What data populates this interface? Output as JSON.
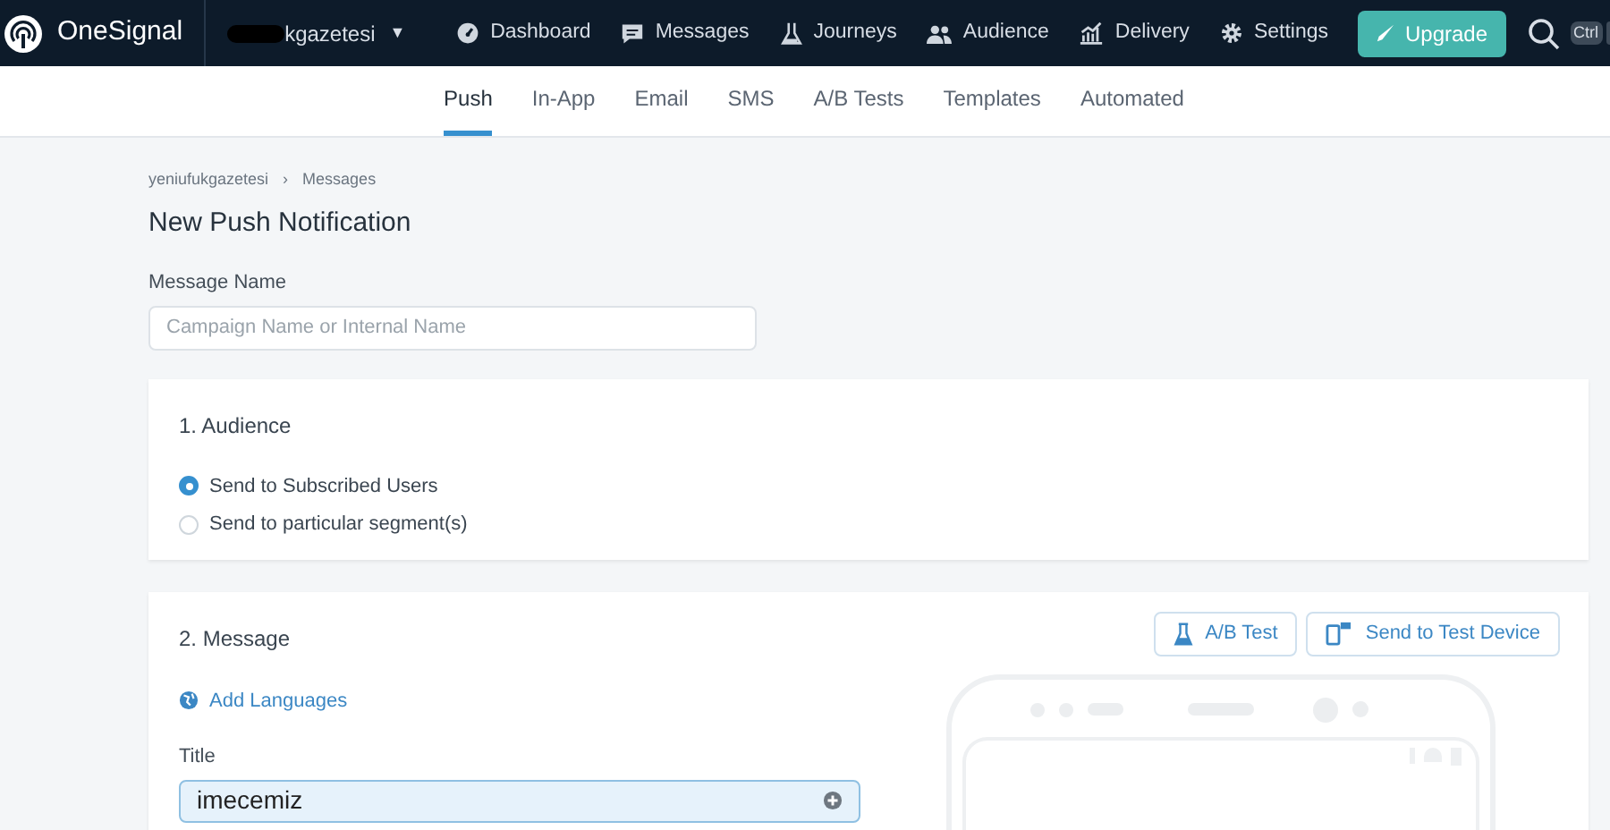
{
  "topbar": {
    "brand": "OneSignal",
    "app_name": "kgazetesi",
    "app_caret": "▼",
    "nav": [
      {
        "label": "Dashboard",
        "kind": "dashboard"
      },
      {
        "label": "Messages",
        "kind": "messages"
      },
      {
        "label": "Journeys",
        "kind": "journeys"
      },
      {
        "label": "Audience",
        "kind": "audience"
      },
      {
        "label": "Delivery",
        "kind": "delivery"
      },
      {
        "label": "Settings",
        "kind": "settings"
      }
    ],
    "upgrade": "Upgrade",
    "shortcut": "Ctrl"
  },
  "subnav": [
    {
      "label": "Push",
      "selected": true
    },
    {
      "label": "In-App",
      "selected": false
    },
    {
      "label": "Email",
      "selected": false
    },
    {
      "label": "SMS",
      "selected": false
    },
    {
      "label": "A/B Tests",
      "selected": false
    },
    {
      "label": "Templates",
      "selected": false
    },
    {
      "label": "Automated",
      "selected": false
    }
  ],
  "breadcrumb": [
    "yeniufukgazetesi",
    "›",
    "Messages"
  ],
  "page_title": "New Push Notification",
  "message_name": {
    "label": "Message Name",
    "placeholder": "Campaign Name or Internal Name"
  },
  "audience": {
    "title": "1. Audience",
    "options": [
      {
        "label": "Send to Subscribed Users",
        "selected": true
      },
      {
        "label": "Send to particular segment(s)",
        "selected": false
      }
    ]
  },
  "message": {
    "title": "2. Message",
    "buttons": [
      {
        "label": "A/B Test",
        "kind": "flask"
      },
      {
        "label": "Send to Test Device",
        "kind": "device"
      }
    ],
    "add_languages": "Add Languages",
    "title_field": {
      "label": "Title",
      "value": "imecemiz"
    }
  }
}
